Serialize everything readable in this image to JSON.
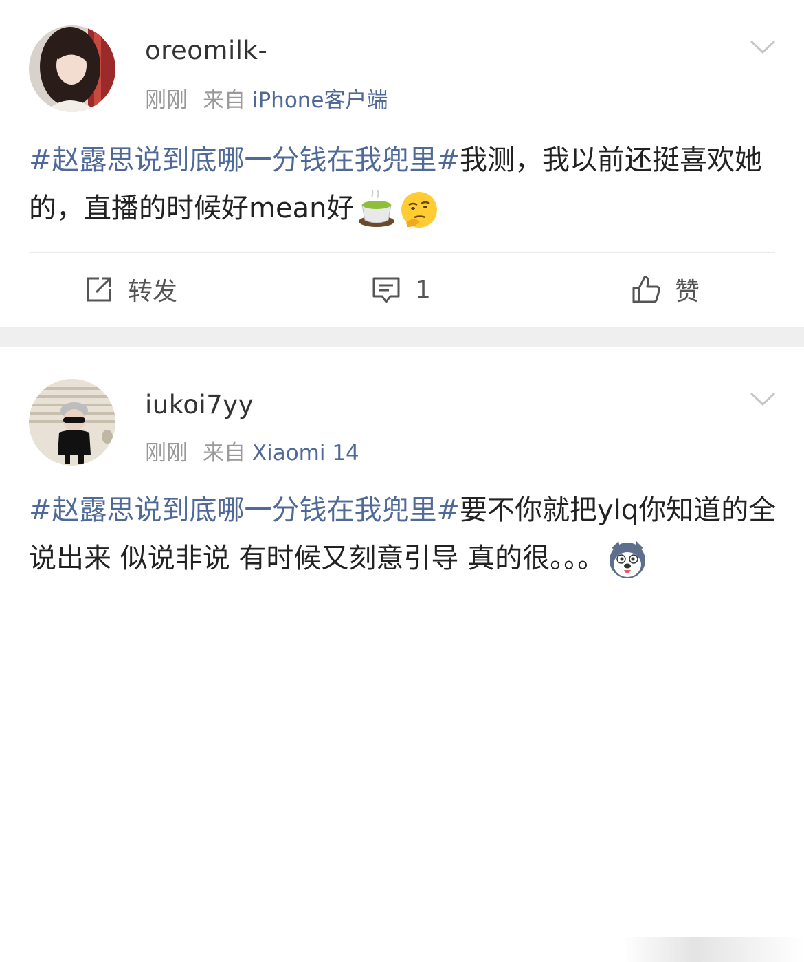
{
  "posts": [
    {
      "username": "oreomilk-",
      "time": "刚刚",
      "from_prefix": "来自",
      "source": "iPhone客户端",
      "hashtag": "#赵露思说到底哪一分钱在我兜里#",
      "text": "我测，我以前还挺喜欢她的，直播的时候好mean好",
      "emojis": [
        "tea-cup-emoji",
        "thinking-face-emoji"
      ],
      "actions": {
        "repost_label": "转发",
        "comment_count": "1",
        "like_label": "赞"
      }
    },
    {
      "username": "iukoi7yy",
      "time": "刚刚",
      "from_prefix": "来自",
      "source": "Xiaomi 14",
      "hashtag": "#赵露思说到底哪一分钱在我兜里#",
      "text": "要不你就把ylq你知道的全说出来 似说非说 有时候又刻意引导 真的很。。。",
      "emojis": [
        "husky-face-emoji"
      ]
    }
  ],
  "colors": {
    "link": "#4f6a99",
    "meta": "#999999",
    "separator_band": "#efefef"
  }
}
